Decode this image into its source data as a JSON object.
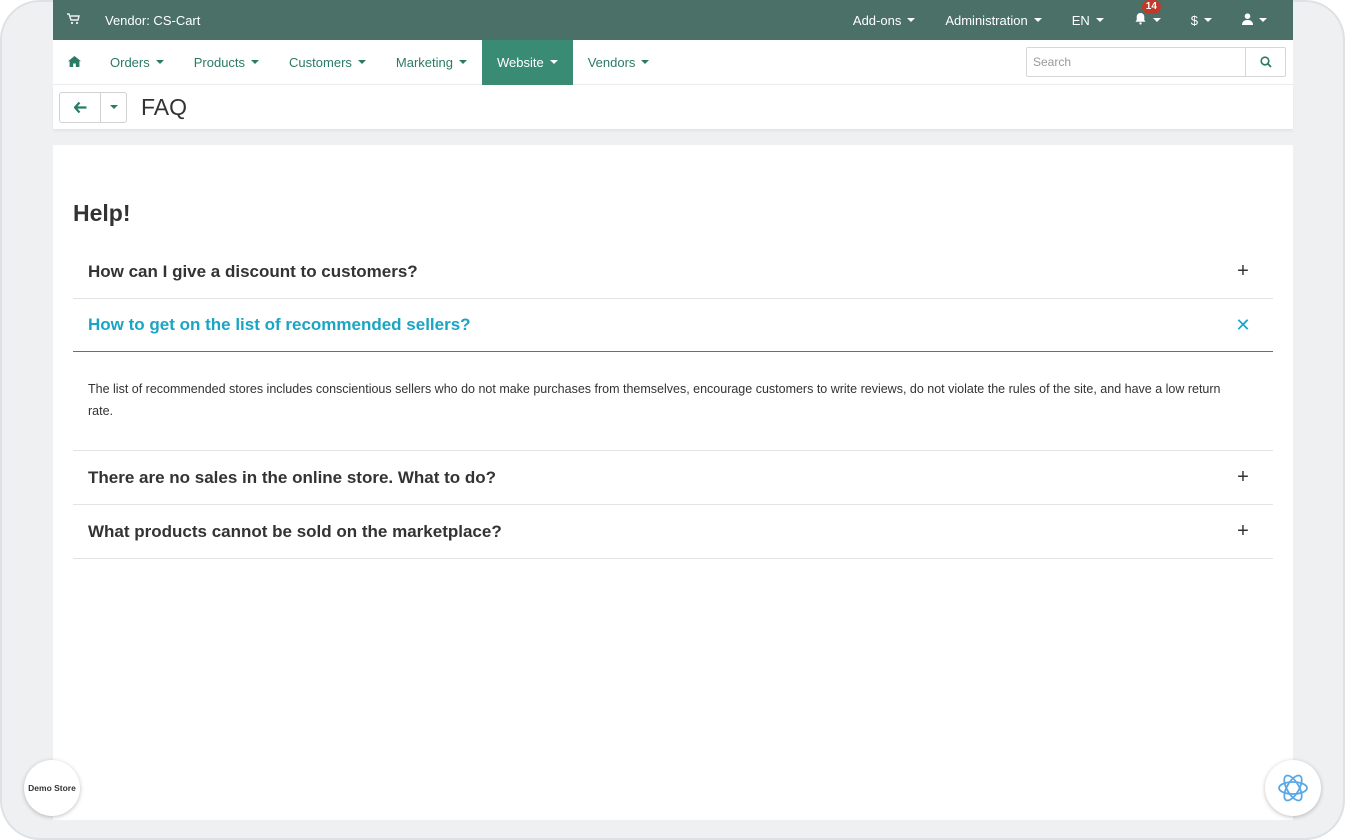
{
  "topbar": {
    "vendor_label": "Vendor: CS-Cart",
    "addons": "Add-ons",
    "administration": "Administration",
    "language": "EN",
    "notifications_count": "14",
    "currency": "$"
  },
  "navbar": {
    "items": [
      {
        "label": "Orders"
      },
      {
        "label": "Products"
      },
      {
        "label": "Customers"
      },
      {
        "label": "Marketing"
      },
      {
        "label": "Website"
      },
      {
        "label": "Vendors"
      }
    ],
    "active": "Website",
    "search_placeholder": "Search"
  },
  "page": {
    "title": "FAQ"
  },
  "faq": {
    "heading": "Help!",
    "items": [
      {
        "question": "How can I give a discount to customers?",
        "open": false
      },
      {
        "question": "How to get on the list of recommended sellers?",
        "open": true,
        "answer": "The list of recommended stores includes conscientious sellers who do not make purchases from themselves, encourage customers to write reviews, do not violate the rules of the site, and have a low return rate."
      },
      {
        "question": "There are no sales in the online store. What to do?",
        "open": false
      },
      {
        "question": "What products cannot be sold on the marketplace?",
        "open": false
      }
    ]
  },
  "badges": {
    "demo_store": "Demo Store"
  },
  "icons": {
    "cart": "cart-icon",
    "home": "home-icon",
    "bell": "bell-icon",
    "user": "user-icon",
    "search": "search-icon",
    "back": "arrow-left-icon",
    "expand": "plus-icon",
    "collapse": "close-icon",
    "ai": "ai-assistant-icon"
  },
  "colors": {
    "topbar_bg": "#4a7067",
    "accent": "#2b7a66",
    "nav_active_bg": "#3a8b74",
    "faq_open_text": "#1aa5c4",
    "badge_red": "#c0392b"
  }
}
